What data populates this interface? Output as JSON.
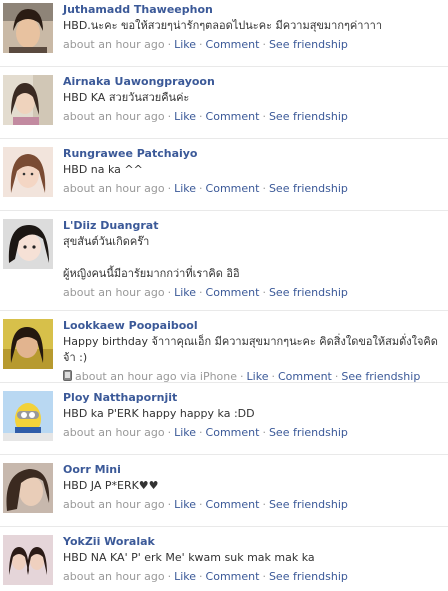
{
  "colors": {
    "link": "#3b5998",
    "meta": "#999999",
    "text": "#333333",
    "divider": "#e9e9e9"
  },
  "posts": [
    {
      "name": "Juthamadd Thaweephon",
      "message": "HBD.นะคะ ขอให้สวยๆน่ารักๆตลอดไปนะคะ มีความสุขมากๆค่าาาา",
      "time": "about an hour ago",
      "via": "",
      "like": "Like",
      "comment": "Comment",
      "friendship": "See friendship",
      "avatar_icon": "profile-photo"
    },
    {
      "name": "Airnaka Uawongprayoon",
      "message": "HBD KA สวยวันสวยคืนค่ะ",
      "time": "about an hour ago",
      "via": "",
      "like": "Like",
      "comment": "Comment",
      "friendship": "See friendship",
      "avatar_icon": "profile-photo"
    },
    {
      "name": "Rungrawee Patchaiyo",
      "message": "HBD na ka ^^",
      "time": "about an hour ago",
      "via": "",
      "like": "Like",
      "comment": "Comment",
      "friendship": "See friendship",
      "avatar_icon": "profile-photo"
    },
    {
      "name": "L'Diiz Duangrat",
      "message": "สุขสันต์วันเกิดคร๊า\n\nผู้หญิงคนนี้มีอารัยมากกว่าที่เราคิด อิอิ",
      "time": "about an hour ago",
      "via": "",
      "like": "Like",
      "comment": "Comment",
      "friendship": "See friendship",
      "avatar_icon": "profile-photo"
    },
    {
      "name": "Lookkaew Poopaibool",
      "message": "Happy birthday จ้าาาคุณเอ็ก มีความสุขมากๆนะคะ คิดสิ่งใดขอให้สมดั่งใจคิดจ้า :)",
      "time": "about an hour ago",
      "via": "via iPhone",
      "like": "Like",
      "comment": "Comment",
      "friendship": "See friendship",
      "avatar_icon": "profile-photo"
    },
    {
      "name": "Ploy Natthapornjit",
      "message": "HBD ka P'ERK happy happy ka :DD",
      "time": "about an hour ago",
      "via": "",
      "like": "Like",
      "comment": "Comment",
      "friendship": "See friendship",
      "avatar_icon": "profile-photo"
    },
    {
      "name": "Oorr Mini",
      "message": "HBD JA P*ERK♥♥",
      "time": "about an hour ago",
      "via": "",
      "like": "Like",
      "comment": "Comment",
      "friendship": "See friendship",
      "avatar_icon": "profile-photo"
    },
    {
      "name": "YokZii Woralak",
      "message": "HBD NA KA' P' erk Me' kwam suk mak mak ka",
      "time": "about an hour ago",
      "via": "",
      "like": "Like",
      "comment": "Comment",
      "friendship": "See friendship",
      "avatar_icon": "profile-photo"
    }
  ]
}
